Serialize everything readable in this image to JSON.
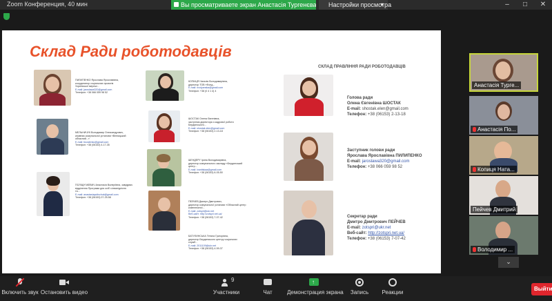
{
  "window": {
    "app_title": "Zoom Конференция, 40 мин",
    "share_banner": "Вы просматриваете экран Анастасія Тургенєва, гарант",
    "view_options": "Настройки просмотра",
    "view_chevron": "▾",
    "min": "–",
    "max": "□",
    "close": "✕"
  },
  "slide": {
    "title": "Склад Ради роботодавців",
    "left_col": [
      {
        "lines": [
          "ПИЛИПЕНКО Ярослава Ярославівна,",
          "координатор соціальних проєктів",
          "Української мережі..."
        ],
        "email": "E-mail: jaroslawa320@gmail.com",
        "phone": "Телефон: +38 066 059 98 52"
      },
      {
        "lines": [
          "МЕЛЬНИЧУК Володимир Олександрович,",
          "керівник комунальної установи «Вінницький",
          "обласний...»"
        ],
        "email": "E-mail: bsvalenko@gmail.com",
        "phone": "Телефон: +38 (06153) 4-17-35"
      },
      {
        "lines": [
          "ПОЛІЩУЧКЕВИЧ Анастасія Валеріївна, завідувач",
          "відділення Програми для осіб з інвалідністю",
          "та..."
        ],
        "email": "E-mail: anastasiapolischuk@gmail.com",
        "phone": "Телефон: +38 (06153) 07-25-58"
      }
    ],
    "mid_col": [
      {
        "lines": [
          "КОПИЦЯ Наталія Володимирівна,",
          "директор ТОВ «Фонд..."
        ],
        "email": "E-mail: nvolyanska@gmail.com",
        "phone": "Телефон: +38 (0 4 1 4) 4"
      },
      {
        "lines": [
          "ШОСТАК Олена Євгенівна,",
          "заступник директора з кадрової роботи",
          "Бердянського..."
        ],
        "email": "E-mail: shostak.elen@gmail.com",
        "phone": "Телефон: +38 (06153) 2-13-18"
      },
      {
        "lines": [
          "ШЕНДЕРУ Ірина Володимирівна,",
          "директор комунального закладу «Бердянський",
          "центр..."
        ],
        "email": "E-mail: ivanitskaa@gmail.com",
        "phone": "Телефон: +38 (06153) 6-05-50"
      },
      {
        "lines": [
          "ПЕЙЧЕВ Дмитро Дмитрович,",
          "директор комунальної установи «Обласний центр",
          "комплексної..."
        ],
        "email": "E-mail: zotspri@ukr.net",
        "web": "Веб-сайт: http://zotspri.net.ua/",
        "phone": "Телефон: +38 (06153) 7-07-42"
      },
      {
        "lines": [
          "БАТУЛИНСЬКА Тетяна Григорівна,",
          "директор Бердянського центру соціальних",
          "служб..."
        ],
        "email": "E-mail: 2011109@ukr.net",
        "phone": "Телефон: +38 (06153) 4-59-37"
      }
    ],
    "right_title": "СКЛАД ПРАВЛІННЯ РАДИ РОБОТОДАВЦІВ",
    "board": [
      {
        "role": "Голова ради",
        "name": "Олена Євгенівна ШОСТАК",
        "email_label": "E-mail:",
        "email": "shostak.elen@gmail.com",
        "phone_label": "Телефон:",
        "phone": "+38 (06153) 2-13-18"
      },
      {
        "role": "Заступник голови ради",
        "name": "Ярослава Ярославівна ПИЛИПЕНКО",
        "email_label": "E-mail:",
        "email": "jaroslawa320@gmail.com",
        "phone_label": "Телефон:",
        "phone": "+38 066 059 98 52"
      },
      {
        "role": "Секретар ради",
        "name": "Дмитро Дмитрович ПЕЙЧЕВ",
        "email_label": "E-mail:",
        "email": "zotspri@ukr.net",
        "web_label": "Веб-сайт:",
        "web": "http://zotspri.net.ua/",
        "phone_label": "Телефон:",
        "phone": "+38 (06153) 7-07-42"
      }
    ]
  },
  "participants": [
    {
      "name": "Анастасія Турге..."
    },
    {
      "name": "Анастасія По..."
    },
    {
      "name": "Копиця Ната..."
    },
    {
      "name": "Пейчев Дмитрий"
    },
    {
      "name": "Володимир ..."
    }
  ],
  "panel_chevron": "⌄",
  "toolbar": {
    "mic": "Включить звук",
    "video": "Остановить видео",
    "participants": "Участники",
    "participants_count": "9",
    "chat": "Чат",
    "share": "Демонстрация экрана",
    "record": "Запись",
    "reactions": "Реакции",
    "leave": "Выйти"
  },
  "colors": {
    "accent": "#e8522a",
    "share": "#2da84a",
    "leave": "#e0262d",
    "active_border": "#c7d63a"
  }
}
